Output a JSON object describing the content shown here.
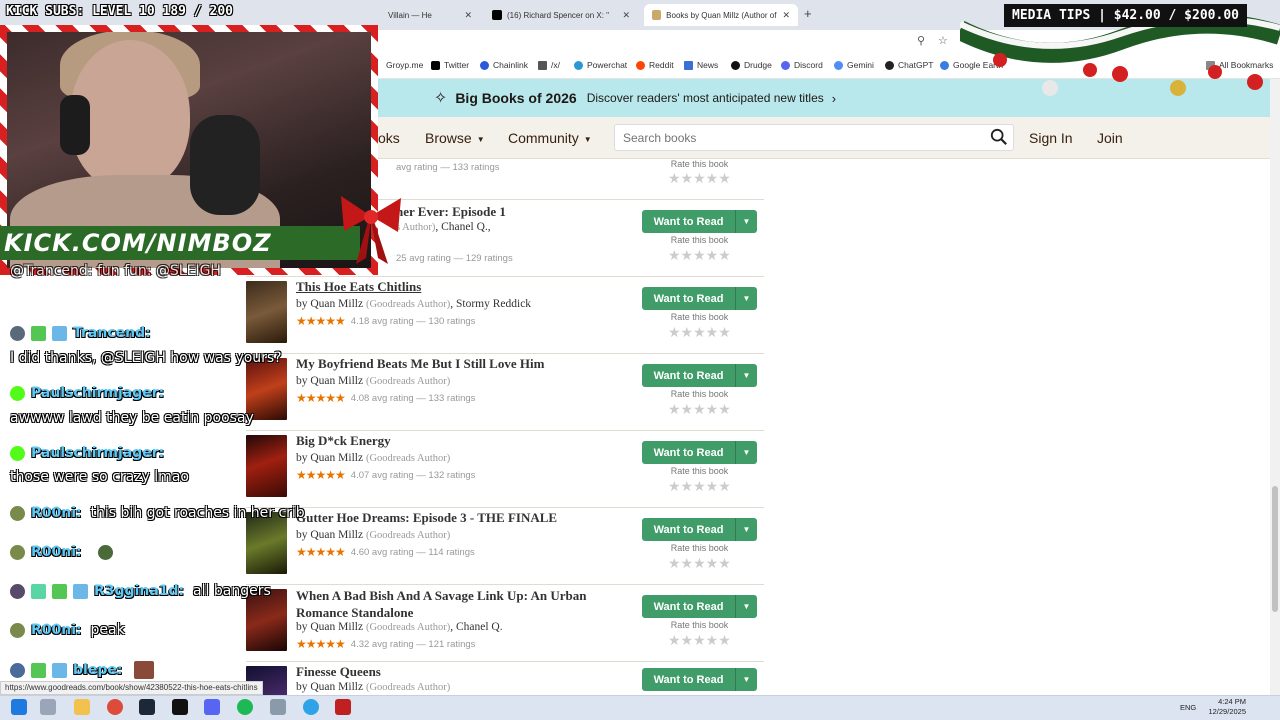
{
  "overlay": {
    "kick_subs": "KICK SUBS: LEVEL 10 189 / 200",
    "media_tips": "MEDIA TIPS | $42.00 / $200.00",
    "url_text": "KICK.COM/NIMBOZ"
  },
  "browser": {
    "tabs": [
      {
        "label": "Villain — He"
      },
      {
        "label": "(16) Richard Spencer on X: \""
      },
      {
        "label": "Books by Quan Millz (Author of"
      }
    ],
    "bookmarks": [
      "Groyp.me",
      "Twitter",
      "Chainlink",
      "/x/",
      "Powerchat",
      "Reddit",
      "News",
      "Drudge",
      "Discord",
      "Gemini",
      "ChatGPT",
      "Google Earth",
      "All Bookmarks"
    ],
    "status_url": "https://www.goodreads.com/book/show/42380522-this-hoe-eats-chitlins"
  },
  "banner": {
    "title": "Big Books of 2026",
    "subtitle": "Discover readers' most anticipated new titles"
  },
  "header": {
    "nav": [
      "oks",
      "Browse",
      "Community"
    ],
    "search_placeholder": "Search books",
    "sign_in": "Sign In",
    "join": "Join"
  },
  "books": [
    {
      "title": "",
      "by": "",
      "gr": "",
      "coauthor": "",
      "rating_text": "avg rating — 133 ratings",
      "stars": "",
      "want": "Want to Read",
      "rate": "Rate this book"
    },
    {
      "title": "ner Ever: Episode 1",
      "by": "",
      "gr": "s Author)",
      "coauthor": ", Chanel Q.,",
      "rating_text": "25 avg rating — 129 ratings",
      "stars": "",
      "want": "Want to Read",
      "rate": "Rate this book"
    },
    {
      "title": "This Hoe Eats Chitlins",
      "by": "by Quan Millz",
      "gr": "(Goodreads Author)",
      "coauthor": ", Stormy Reddick",
      "rating_text": "4.18 avg rating — 130 ratings",
      "stars": "★★★★★",
      "want": "Want to Read",
      "rate": "Rate this book"
    },
    {
      "title": "My Boyfriend Beats Me But I Still Love Him",
      "by": "by Quan Millz",
      "gr": "(Goodreads Author)",
      "coauthor": "",
      "rating_text": "4.08 avg rating — 133 ratings",
      "stars": "★★★★★",
      "want": "Want to Read",
      "rate": "Rate this book"
    },
    {
      "title": "Big D*ck Energy",
      "by": "by Quan Millz",
      "gr": "(Goodreads Author)",
      "coauthor": "",
      "rating_text": "4.07 avg rating — 132 ratings",
      "stars": "★★★★★",
      "want": "Want to Read",
      "rate": "Rate this book"
    },
    {
      "title": "Gutter Hoe Dreams: Episode 3 - THE FINALE",
      "by": "by Quan Millz",
      "gr": "(Goodreads Author)",
      "coauthor": "",
      "rating_text": "4.60 avg rating — 114 ratings",
      "stars": "★★★★★",
      "want": "Want to Read",
      "rate": "Rate this book"
    },
    {
      "title": "When A Bad Bish And A Savage Link Up: An Urban Romance Standalone",
      "by": "by Quan Millz",
      "gr": "(Goodreads Author)",
      "coauthor": ", Chanel Q.",
      "rating_text": "4.32 avg rating — 121 ratings",
      "stars": "★★★★★",
      "want": "Want to Read",
      "rate": "Rate this book"
    },
    {
      "title": "Finesse Queens",
      "by": "by Quan Millz",
      "gr": "(Goodreads Author)",
      "coauthor": "",
      "rating_text": "",
      "stars": "",
      "want": "Want to Read",
      "rate": ""
    }
  ],
  "chat": [
    {
      "name": "",
      "msg": "@Trancend: fun fun: @SLEIGH"
    },
    {
      "name": "Trancend:",
      "msg": ""
    },
    {
      "name": "",
      "msg": "I did thanks, @SLEIGH how was yours?"
    },
    {
      "name": "Paulschirmjager:",
      "msg": ""
    },
    {
      "name": "",
      "msg": "awwww lawd they be eatin poosay"
    },
    {
      "name": "Paulschirmjager:",
      "msg": ""
    },
    {
      "name": "",
      "msg": "those were so crazy lmao"
    },
    {
      "name": "R00ni:",
      "msg": "this bih got roaches in her crib"
    },
    {
      "name": "R00ni:",
      "msg": ""
    },
    {
      "name": "R3ggina1d:",
      "msg": "all bangers"
    },
    {
      "name": "R00ni:",
      "msg": "peak"
    },
    {
      "name": "blepe:",
      "msg": ""
    }
  ],
  "tray": {
    "lang": "ENG",
    "time": "4:24 PM",
    "date": "12/29/2025"
  },
  "colors": {
    "goodreads_green": "#409d69",
    "banner_bg": "#b9e8ec",
    "header_bg": "#f4f1ea",
    "star_orange": "#e87400",
    "chat_name": "#5ec8f5"
  }
}
